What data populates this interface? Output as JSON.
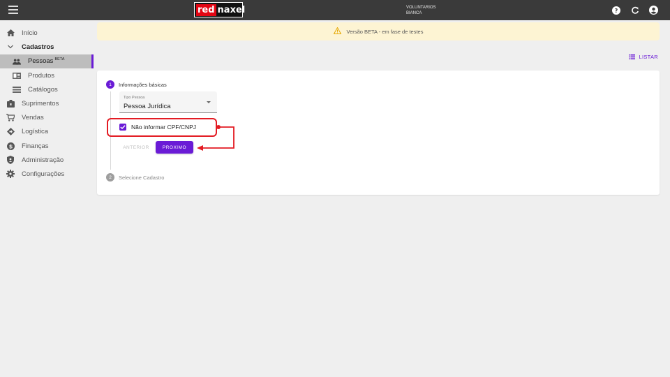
{
  "header": {
    "logo_red": "red",
    "logo_rest": "naxel",
    "org_name": "VOLUNTARIOS",
    "user_name": "BIANCA",
    "icons": [
      "menu-icon",
      "help-icon",
      "refresh-icon",
      "account-icon"
    ]
  },
  "sidebar": {
    "items": [
      {
        "label": "Início",
        "icon": "home-icon"
      },
      {
        "label": "Cadastros",
        "icon": "chevron-down-icon"
      },
      {
        "label": "Pessoas",
        "badge": "BETA",
        "icon": "people-icon",
        "active": true
      },
      {
        "label": "Produtos",
        "icon": "product-icon"
      },
      {
        "label": "Catálogos",
        "icon": "list-icon"
      },
      {
        "label": "Suprimentos",
        "icon": "supply-icon"
      },
      {
        "label": "Vendas",
        "icon": "cart-icon"
      },
      {
        "label": "Logística",
        "icon": "logistics-icon"
      },
      {
        "label": "Finanças",
        "icon": "dollar-icon"
      },
      {
        "label": "Administração",
        "icon": "shield-icon"
      },
      {
        "label": "Configurações",
        "icon": "gear-icon"
      }
    ]
  },
  "banner": {
    "text": "Versão BETA - em fase de testes"
  },
  "actions": {
    "listar_label": "LISTAR"
  },
  "stepper": {
    "step1": {
      "number": "1",
      "label": "Informações básicas"
    },
    "step2": {
      "number": "2",
      "label": "Selecione Cadastro"
    },
    "tipo_pessoa": {
      "label": "Tipo Pessoa",
      "value": "Pessoa Jurídica"
    },
    "checkbox": {
      "label": "Não informar CPF/CNPJ",
      "checked": true
    },
    "anterior_label": "ANTERIOR",
    "proximo_label": "PROXIMO"
  },
  "colors": {
    "accent": "#6a1bd6",
    "topbar": "#3a3a3a",
    "banner_bg": "#fdf4d3",
    "annotation": "#e31b23"
  }
}
